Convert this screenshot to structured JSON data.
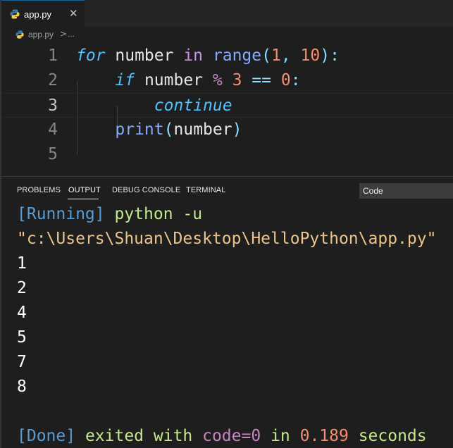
{
  "tab": {
    "label": "app.py",
    "close": "✕",
    "icon": "python-file-icon"
  },
  "breadcrumb": {
    "file": "app.py",
    "separator": ">",
    "more": "..."
  },
  "editor": {
    "line_numbers": [
      "1",
      "2",
      "3",
      "4",
      "5"
    ],
    "current_line": 3,
    "line1": {
      "kw": "for",
      "var": " number ",
      "in": "in",
      "fn": " range",
      "open": "(",
      "n1": "1",
      "comma": ", ",
      "n2": "10",
      "close": "):"
    },
    "line2": {
      "indent": "    ",
      "kw": "if",
      "var": " number ",
      "mod": "%",
      "n1": " 3",
      "eq": " == ",
      "n2": "0",
      "colon": ":"
    },
    "line3": {
      "indent": "        ",
      "kw": "continue"
    },
    "line4": {
      "indent": "    ",
      "fn": "print",
      "open": "(",
      "var": "number",
      "close": ")"
    }
  },
  "panel": {
    "tabs": [
      "PROBLEMS",
      "OUTPUT",
      "DEBUG CONSOLE",
      "TERMINAL"
    ],
    "active_tab": "OUTPUT",
    "channel": "Code"
  },
  "output": {
    "running_tag": "[Running]",
    "command": " python -u",
    "path": "\"c:\\Users\\Shuan\\Desktop\\HelloPython\\app.py\"",
    "results": [
      "1",
      "2",
      "4",
      "5",
      "7",
      "8"
    ],
    "done_tag": "[Done]",
    "exited_text": " exited with ",
    "code_text": "code=0",
    "in_text": " in ",
    "seconds_value": "0.189",
    "seconds_text": " seconds"
  },
  "colors": {
    "background": "#1e1e1e",
    "accent": "#0e639c"
  }
}
